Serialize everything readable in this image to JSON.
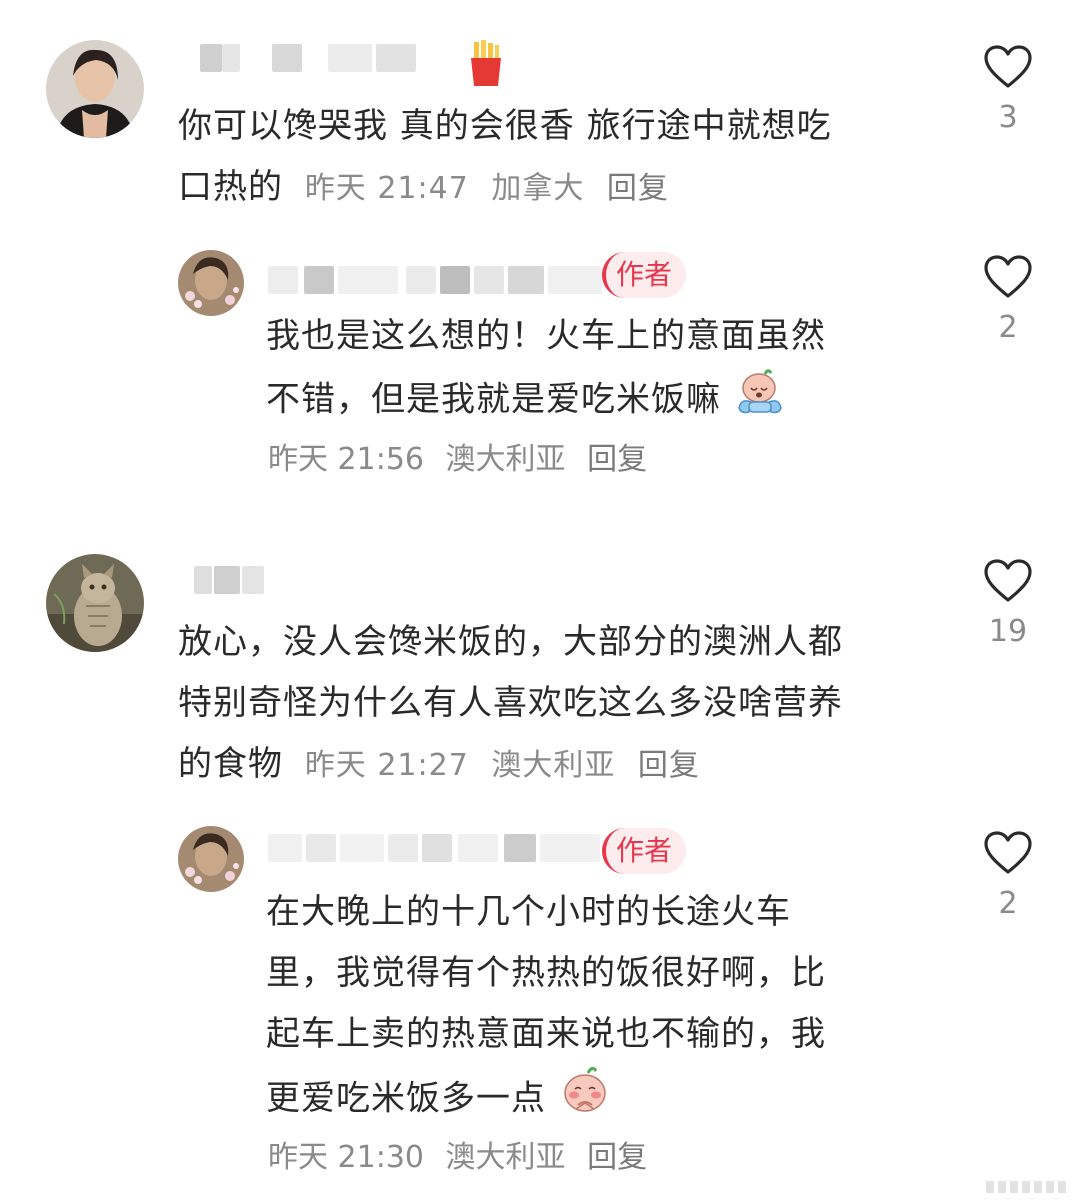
{
  "comments": [
    {
      "text_lines": [
        "你可以馋哭我 真的会很香 旅行途中就想吃",
        "口热的"
      ],
      "time": "昨天 21:47",
      "location": "加拿大",
      "reply_label": "回复",
      "likes": "3",
      "reply": {
        "author_badge": "作者",
        "text_lines": [
          "我也是这么想的！火车上的意面虽然",
          "不错，但是我就是爱吃米饭嘛"
        ],
        "time": "昨天 21:56",
        "location": "澳大利亚",
        "reply_label": "回复",
        "likes": "2"
      }
    },
    {
      "text_lines": [
        "放心，没人会馋米饭的，大部分的澳洲人都",
        "特别奇怪为什么有人喜欢吃这么多没啥营养",
        "的食物"
      ],
      "time": "昨天 21:27",
      "location": "澳大利亚",
      "reply_label": "回复",
      "likes": "19",
      "reply": {
        "author_badge": "作者",
        "text_lines": [
          "在大晚上的十几个小时的长途火车",
          "里，我觉得有个热热的饭很好啊，比",
          "起车上卖的热意面来说也不输的，我",
          "更爱吃米饭多一点"
        ],
        "time": "昨天 21:30",
        "location": "澳大利亚",
        "reply_label": "回复",
        "likes": "2"
      }
    }
  ],
  "icons": {
    "like": "heart-outline-icon",
    "fries": "french-fries-icon",
    "emoji_crying": "crying-emoji-icon",
    "emoji_shy": "shy-emoji-icon"
  },
  "colors": {
    "text": "#2a2a2a",
    "meta": "#8a8a8a",
    "author_badge": "#e8364b",
    "author_badge_bg": "#fdecee"
  }
}
